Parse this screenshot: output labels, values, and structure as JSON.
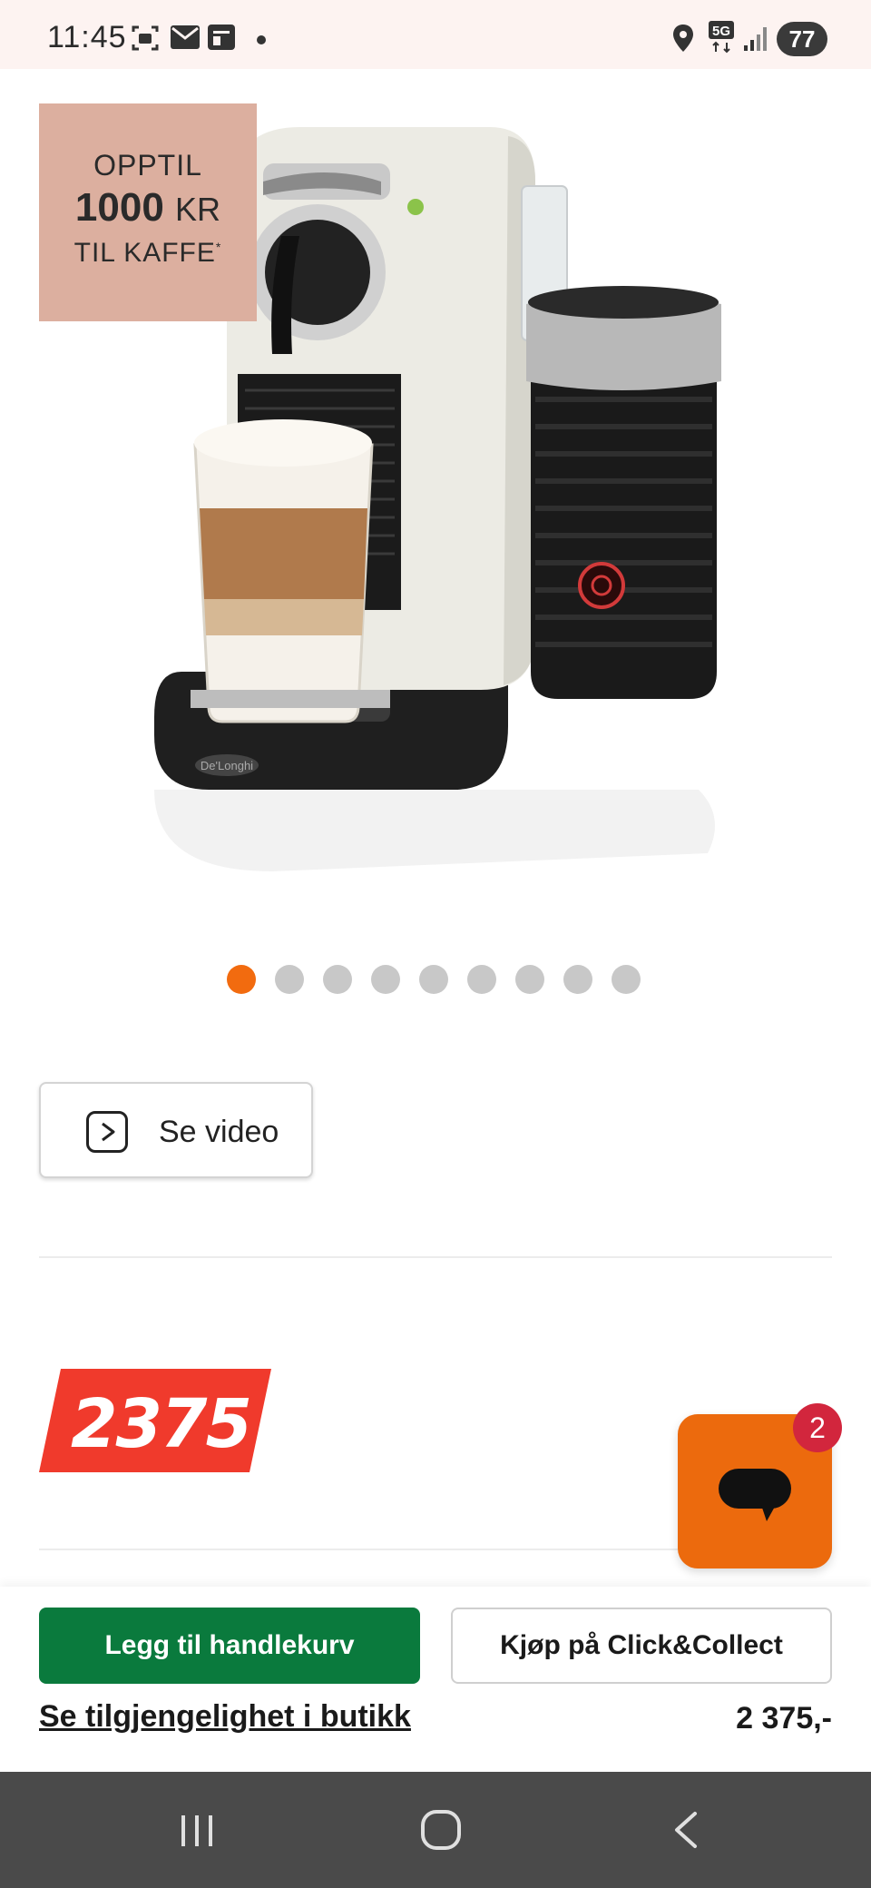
{
  "status_bar": {
    "time": "11:45",
    "battery": "77",
    "network": "5G",
    "icons": [
      "screenshot-icon",
      "mail-icon",
      "news-icon",
      "dot-icon",
      "location-icon",
      "signal-icon"
    ]
  },
  "gallery": {
    "promo_line1": "OPPTIL",
    "promo_amount": "1000",
    "promo_unit": "KR",
    "promo_line3": "TIL KAFFE",
    "promo_mark": "*",
    "product_brand": "De'Longhi",
    "total_images": 9,
    "active_index": 0
  },
  "video_button": {
    "label": "Se video"
  },
  "price": {
    "value": "2375"
  },
  "chat": {
    "badge_count": "2"
  },
  "actions": {
    "add_to_cart": "Legg til handlekurv",
    "click_collect": "Kjøp på Click&Collect",
    "store_availability": "Se tilgjengelighet i butikk",
    "price_display": "2 375,-"
  },
  "colors": {
    "accent_orange": "#f26b0f",
    "price_red": "#f03a2c",
    "cart_green": "#0a7a3d",
    "badge_red": "#d2263d",
    "promo_pink": "#dcaf9f"
  }
}
